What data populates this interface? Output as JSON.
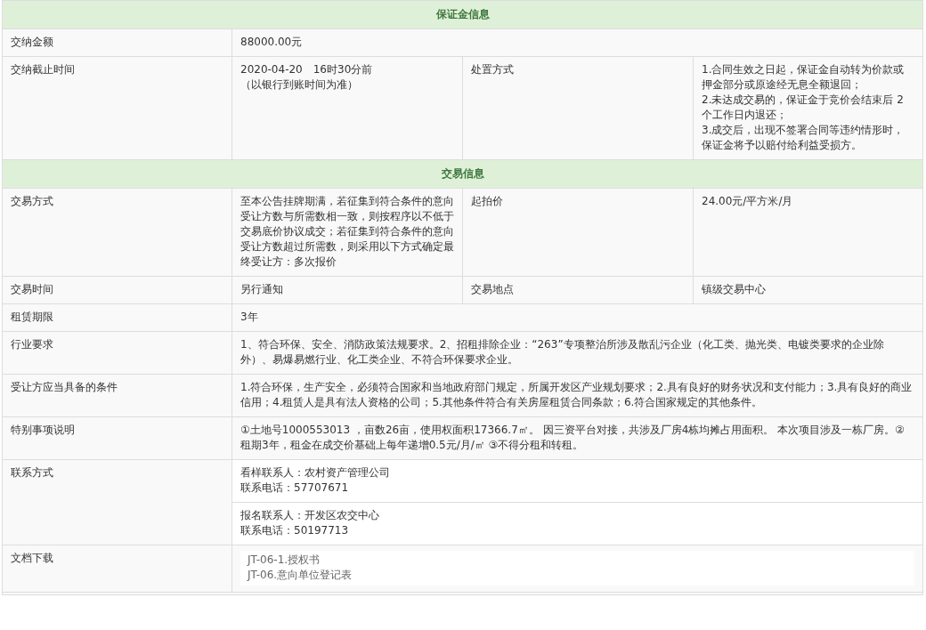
{
  "rows": [
    {
      "kind": "section",
      "title": "保证金信息"
    },
    {
      "kind": "wide",
      "label": "交纳金额",
      "lines": [
        "88000.00元"
      ]
    },
    {
      "kind": "quad",
      "label": "交纳截止时间",
      "lines": [
        "2020-04-20　16时30分前",
        "（以银行到账时间为准）"
      ],
      "label2": "处置方式",
      "lines2": [
        "1.合同生效之日起，保证金自动转为价款或押金部分或原途经无息全额退回；",
        "2.未达成交易的，保证金于竞价会结束后 2 个工作日内退还；",
        "3.成交后，出现不签署合同等违约情形时，保证金将予以赔付给利益受损方。"
      ]
    },
    {
      "kind": "section",
      "title": "交易信息"
    },
    {
      "kind": "quad",
      "label": "交易方式",
      "lines": [
        "至本公告挂牌期满，若征集到符合条件的意向受让方数与所需数相一致，则按程序以不低于交易底价协议成交；若征集到符合条件的意向受让方数超过所需数，则采用以下方式确定最终受让方：多次报价"
      ],
      "label2": "起拍价",
      "lines2": [
        "24.00元/平方米/月"
      ]
    },
    {
      "kind": "quad",
      "label": "交易时间",
      "lines": [
        "另行通知"
      ],
      "label2": "交易地点",
      "lines2": [
        "镇级交易中心"
      ]
    },
    {
      "kind": "wide",
      "label": "租赁期限",
      "lines": [
        "3年"
      ]
    },
    {
      "kind": "wide",
      "label": "行业要求",
      "lines": [
        "1、符合环保、安全、消防政策法规要求。2、招租排除企业：“263”专项整治所涉及散乱污企业（化工类、抛光类、电镀类要求的企业除外）、易爆易燃行业、化工类企业、不符合环保要求企业。"
      ]
    },
    {
      "kind": "wide",
      "label": "受让方应当具备的条件",
      "lines": [
        "1.符合环保，生产安全，必须符合国家和当地政府部门规定，所属开发区产业规划要求；2.具有良好的财务状况和支付能力；3.具有良好的商业信用；4.租赁人是具有法人资格的公司；5.其他条件符合有关房屋租赁合同条款；6.符合国家规定的其他条件。"
      ]
    },
    {
      "kind": "wide",
      "label": "特别事项说明",
      "lines": [
        "①土地号1000553013 ，亩数26亩，使用权面积17366.7㎡。 因三资平台对接，共涉及厂房4栋均摊占用面积。 本次项目涉及一栋厂房。②租期3年，租金在成交价基础上每年递增0.5元/月/㎡ ③不得分租和转租。"
      ]
    },
    {
      "kind": "contacts",
      "label": "联系方式",
      "blocks": [
        [
          "看样联系人：农村资产管理公司",
          "联系电话：57707671"
        ],
        [
          "报名联系人：开发区农交中心",
          "联系电话：50197713"
        ]
      ]
    },
    {
      "kind": "files",
      "label": "文档下载",
      "files": [
        "JT-06-1.授权书",
        "JT-06.意向单位登记表"
      ]
    },
    {
      "kind": "blank"
    }
  ]
}
